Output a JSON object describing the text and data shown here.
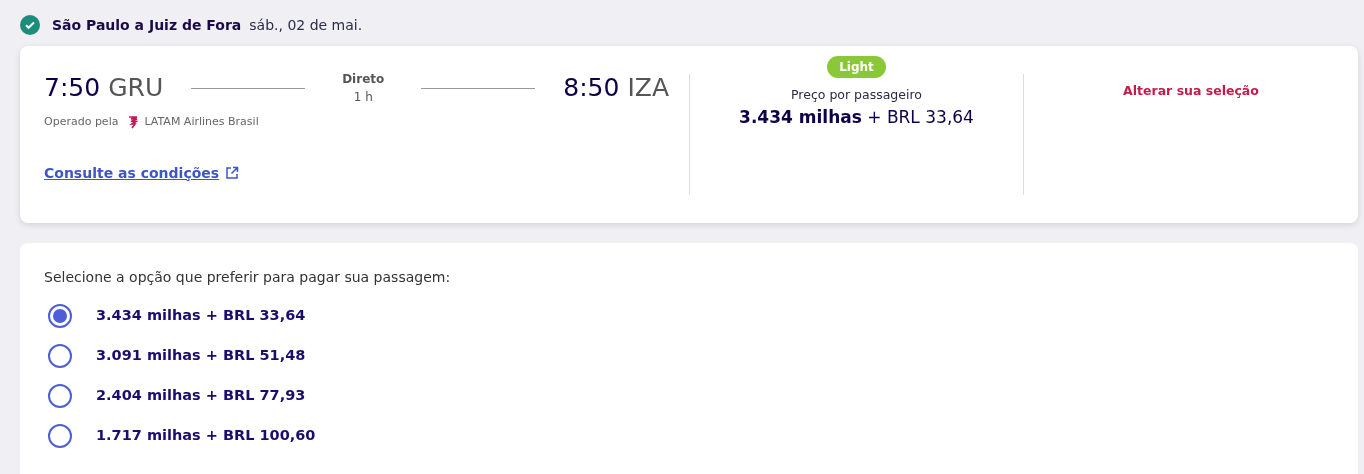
{
  "header": {
    "confirmed": true,
    "route": "São Paulo a Juiz de Fora",
    "date": "sáb., 02 de mai."
  },
  "flight": {
    "departure": {
      "time": "7:50",
      "airport": "GRU"
    },
    "stops": "Direto",
    "duration": "1 h",
    "arrival": {
      "time": "8:50",
      "airport": "IZA"
    },
    "operated_label": "Operado pela",
    "airline": "LATAM Airlines Brasil",
    "conditions_link": "Consulte as condições"
  },
  "fare": {
    "badge": "Light",
    "price_label": "Preço por passageiro",
    "price": "**3.434 milhas** + BRL 33,64"
  },
  "change_link": "Alterar sua seleção",
  "payment": {
    "prompt": "Selecione a opção que preferir para pagar sua passagem:",
    "options": [
      {
        "label": "3.434 milhas + BRL 33,64",
        "selected": true
      },
      {
        "label": "3.091 milhas + BRL 51,48",
        "selected": false
      },
      {
        "label": "2.404 milhas + BRL 77,93",
        "selected": false
      },
      {
        "label": "1.717 milhas + BRL 100,60",
        "selected": false
      }
    ]
  }
}
